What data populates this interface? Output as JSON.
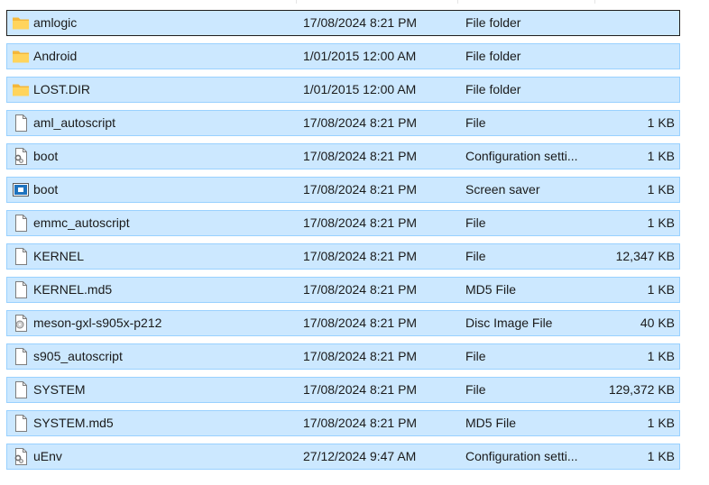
{
  "files": [
    {
      "name": "amlogic",
      "date": "17/08/2024 8:21 PM",
      "type": "File folder",
      "size": "",
      "icon": "folder-icon"
    },
    {
      "name": "Android",
      "date": "1/01/2015 12:00 AM",
      "type": "File folder",
      "size": "",
      "icon": "folder-icon"
    },
    {
      "name": "LOST.DIR",
      "date": "1/01/2015 12:00 AM",
      "type": "File folder",
      "size": "",
      "icon": "folder-icon"
    },
    {
      "name": "aml_autoscript",
      "date": "17/08/2024 8:21 PM",
      "type": "File",
      "size": "1 KB",
      "icon": "file-icon"
    },
    {
      "name": "boot",
      "date": "17/08/2024 8:21 PM",
      "type": "Configuration setti...",
      "size": "1 KB",
      "icon": "config-file-icon"
    },
    {
      "name": "boot",
      "date": "17/08/2024 8:21 PM",
      "type": "Screen saver",
      "size": "1 KB",
      "icon": "screensaver-icon"
    },
    {
      "name": "emmc_autoscript",
      "date": "17/08/2024 8:21 PM",
      "type": "File",
      "size": "1 KB",
      "icon": "file-icon"
    },
    {
      "name": "KERNEL",
      "date": "17/08/2024 8:21 PM",
      "type": "File",
      "size": "12,347 KB",
      "icon": "file-icon"
    },
    {
      "name": "KERNEL.md5",
      "date": "17/08/2024 8:21 PM",
      "type": "MD5 File",
      "size": "1 KB",
      "icon": "file-icon"
    },
    {
      "name": "meson-gxl-s905x-p212",
      "date": "17/08/2024 8:21 PM",
      "type": "Disc Image File",
      "size": "40 KB",
      "icon": "disc-image-icon"
    },
    {
      "name": "s905_autoscript",
      "date": "17/08/2024 8:21 PM",
      "type": "File",
      "size": "1 KB",
      "icon": "file-icon"
    },
    {
      "name": "SYSTEM",
      "date": "17/08/2024 8:21 PM",
      "type": "File",
      "size": "129,372 KB",
      "icon": "file-icon"
    },
    {
      "name": "SYSTEM.md5",
      "date": "17/08/2024 8:21 PM",
      "type": "MD5 File",
      "size": "1 KB",
      "icon": "file-icon"
    },
    {
      "name": "uEnv",
      "date": "27/12/2024 9:47 AM",
      "type": "Configuration setti...",
      "size": "1 KB",
      "icon": "config-file-icon"
    }
  ],
  "colors": {
    "selection_bg": "#cce8ff",
    "selection_border": "#99d1ff",
    "focus_border": "#1f1f1f",
    "folder": "#f8c74a"
  }
}
